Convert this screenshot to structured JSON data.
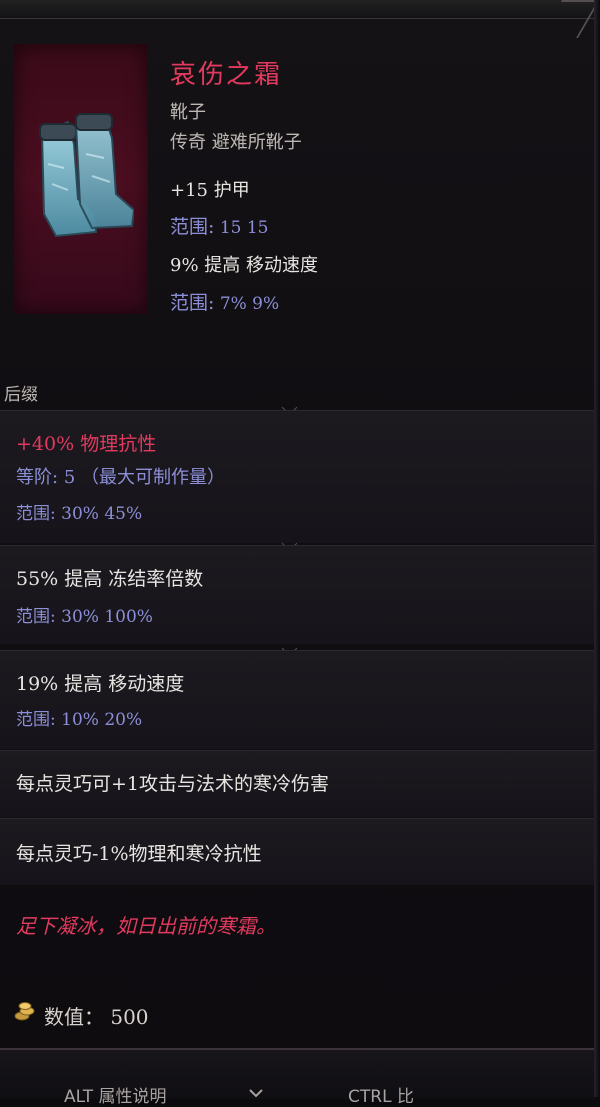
{
  "item": {
    "name": "哀伤之霜",
    "type": "靴子",
    "rarity_line": "传奇 避难所靴子",
    "implicits": [
      {
        "text": "+15 护甲",
        "range_label": "范围:",
        "range_values": "15  15"
      },
      {
        "text": "9% 提高 移动速度",
        "range_label": "范围:",
        "range_values": "7%  9%"
      }
    ]
  },
  "section_label": "后缀",
  "affixes": [
    {
      "text": "+40% 物理抗性",
      "color": "#e23a5f",
      "tier_label": "等阶:",
      "tier_value": "5 （最大可制作量）",
      "range_label": "范围:",
      "range_values": "30%  45%"
    },
    {
      "text": "55% 提高 冻结率倍数",
      "color": "#e8e4e2",
      "range_label": "范围:",
      "range_values": "30%  100%"
    },
    {
      "text": "19% 提高 移动速度",
      "color": "#e8e4e2",
      "range_label": "范围:",
      "range_values": "10%  20%"
    },
    {
      "text": "每点灵巧可+1攻击与法术的寒冷伤害",
      "color": "#e8e4e2"
    },
    {
      "text": "每点灵巧-1%物理和寒冷抗性",
      "color": "#e8e4e2"
    }
  ],
  "flavor_text": "足下凝冰，如日出前的寒霜。",
  "value": {
    "label": "数值：",
    "amount": "500"
  },
  "hints": {
    "alt": "ALT 属性说明",
    "ctrl": "CTRL 比"
  },
  "colors": {
    "legendary": "#e23a5f",
    "range": "#8c8fd8",
    "tier": "#8c8fd8"
  }
}
